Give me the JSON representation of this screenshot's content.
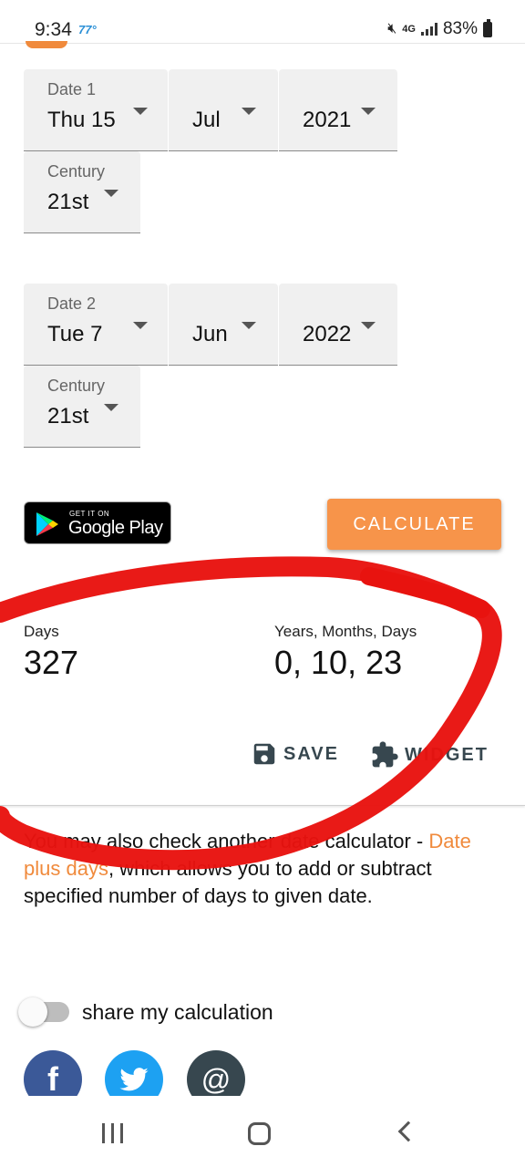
{
  "status_bar": {
    "time": "9:34",
    "temperature": "77°",
    "network": "4G",
    "battery": "83%"
  },
  "date1": {
    "label": "Date 1",
    "day": "Thu 15",
    "month": "Jul",
    "year": "2021",
    "century_label": "Century",
    "century": "21st"
  },
  "date2": {
    "label": "Date 2",
    "day": "Tue 7",
    "month": "Jun",
    "year": "2022",
    "century_label": "Century",
    "century": "21st"
  },
  "google_play": {
    "small_text": "GET IT ON",
    "big_text": "Google Play"
  },
  "calculate_label": "CALCULATE",
  "results": {
    "days_label": "Days",
    "days_value": "327",
    "ymd_label": "Years, Months, Days",
    "ymd_value": "0, 10, 23"
  },
  "actions": {
    "save_label": "SAVE",
    "widget_label": "WIDGET"
  },
  "info": {
    "prefix": "You may also check another date calculator - ",
    "link": "Date plus days",
    "suffix": ", which allows you to add or subtract specified number of days to given date."
  },
  "share": {
    "label": "share my calculation",
    "enabled": false
  },
  "social": {
    "facebook_glyph": "f",
    "email_glyph": "@"
  },
  "colors": {
    "accent": "#f7944a",
    "link": "#f08a3c",
    "annotation": "#e8130f",
    "facebook": "#3b5998",
    "twitter": "#1da1f2",
    "email": "#37474f"
  }
}
